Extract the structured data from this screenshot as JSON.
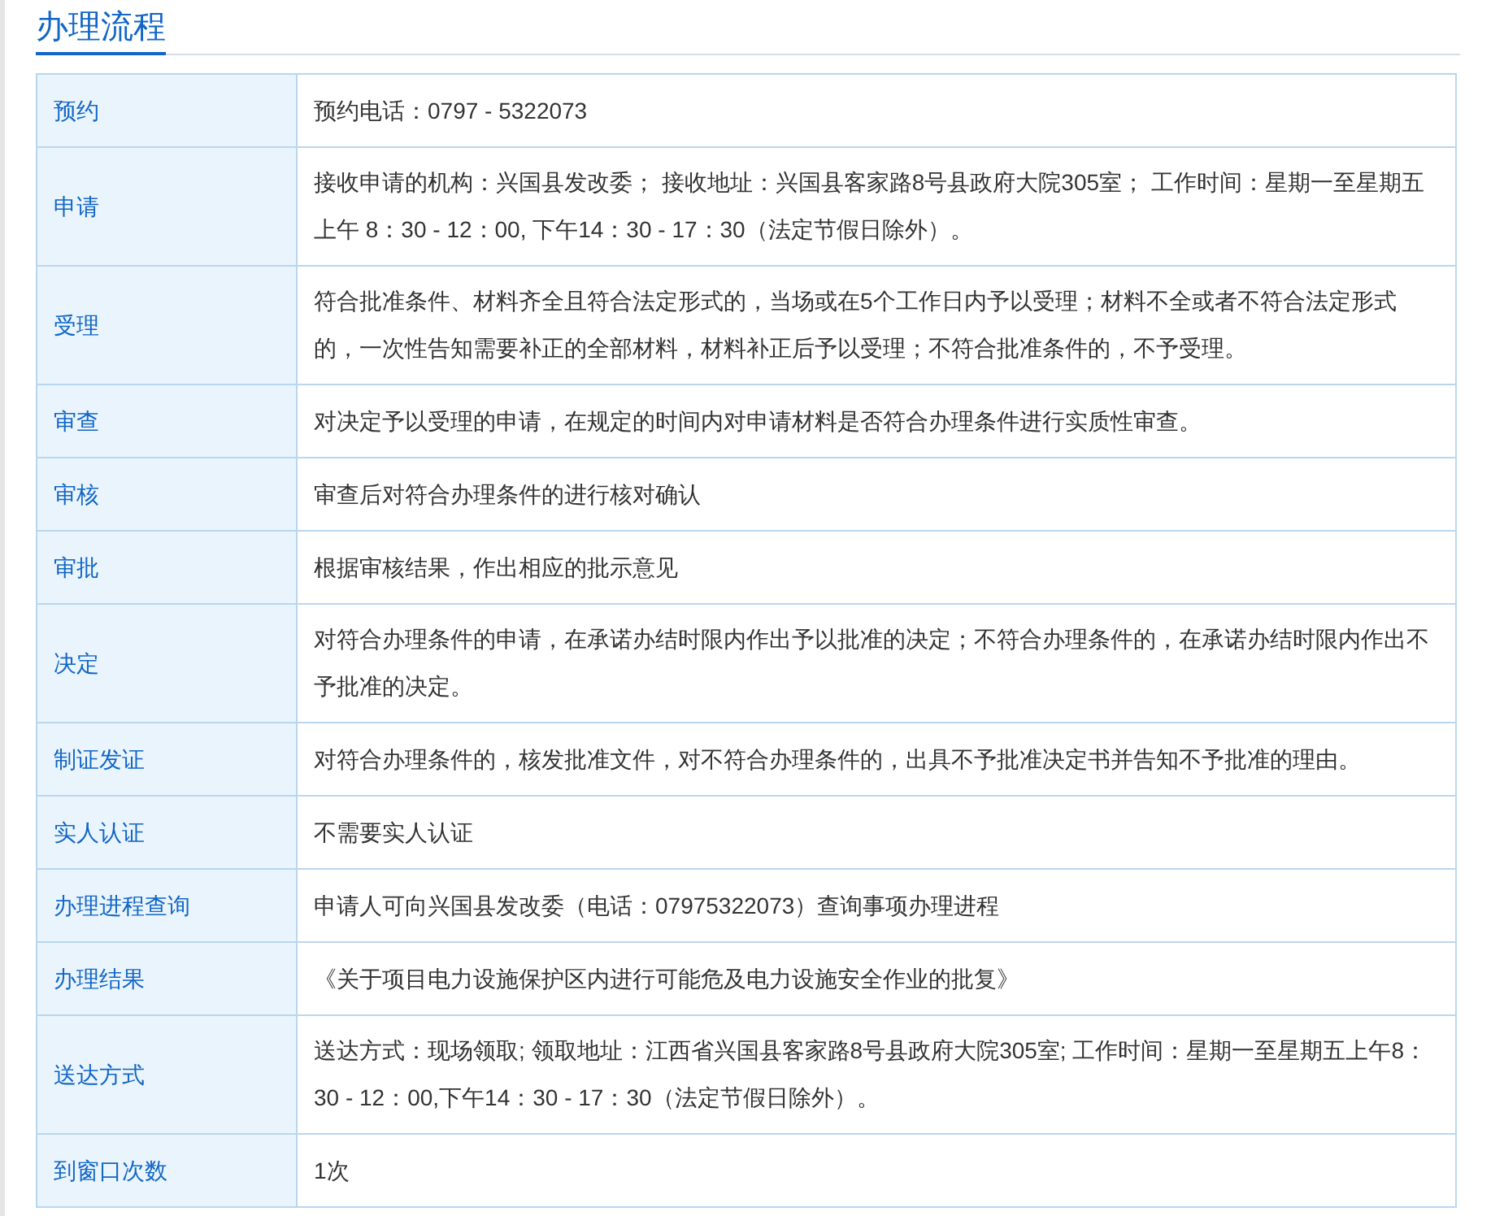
{
  "section_title": "办理流程",
  "rows": [
    {
      "label": "预约",
      "value": "预约电话：0797 - 5322073"
    },
    {
      "label": "申请",
      "value": "接收申请的机构：兴国县发改委；  接收地址：兴国县客家路8号县政府大院305室；  工作时间：星期一至星期五上午 8：30 - 12：00, 下午14：30 - 17：30（法定节假日除外）。"
    },
    {
      "label": "受理",
      "value": "符合批准条件、材料齐全且符合法定形式的，当场或在5个工作日内予以受理；材料不全或者不符合法定形式的，一次性告知需要补正的全部材料，材料补正后予以受理；不符合批准条件的，不予受理。"
    },
    {
      "label": "审查",
      "value": "对决定予以受理的申请，在规定的时间内对申请材料是否符合办理条件进行实质性审查。"
    },
    {
      "label": "审核",
      "value": "审查后对符合办理条件的进行核对确认"
    },
    {
      "label": "审批",
      "value": "根据审核结果，作出相应的批示意见"
    },
    {
      "label": "决定",
      "value": "对符合办理条件的申请，在承诺办结时限内作出予以批准的决定；不符合办理条件的，在承诺办结时限内作出不予批准的决定。"
    },
    {
      "label": "制证发证",
      "value": "对符合办理条件的，核发批准文件，对不符合办理条件的，出具不予批准决定书并告知不予批准的理由。"
    },
    {
      "label": "实人认证",
      "value": "不需要实人认证"
    },
    {
      "label": "办理进程查询",
      "value": "申请人可向兴国县发改委（电话：07975322073）查询事项办理进程"
    },
    {
      "label": "办理结果",
      "value": "《关于项目电力设施保护区内进行可能危及电力设施安全作业的批复》"
    },
    {
      "label": "送达方式",
      "value": "送达方式：现场领取; 领取地址：江西省兴国县客家路8号县政府大院305室; 工作时间：星期一至星期五上午8：30 - 12：00,下午14：30 - 17：30（法定节假日除外）。"
    },
    {
      "label": "到窗口次数",
      "value": "1次"
    }
  ]
}
